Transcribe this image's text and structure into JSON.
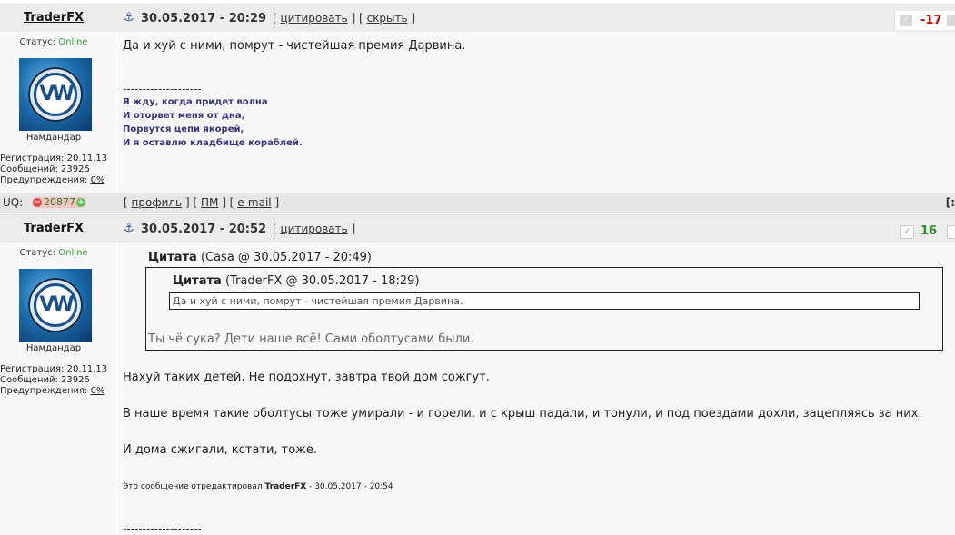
{
  "posts": [
    {
      "author": "TraderFX",
      "date": "30.05.2017 - 20:29",
      "links": {
        "open": "[",
        "quote": "цитировать",
        "mid": "] [",
        "hide": "скрыть",
        "close": "]"
      },
      "rating": "-17",
      "status_label": "Статус:",
      "status_value": "Online",
      "rank": "Намдандар",
      "reg": "Регистрация: 20.11.13",
      "msgs": "Сообщений: 23925",
      "warn_label": "Предупреждения:",
      "warn_value": "0%",
      "text": "Да и хуй с ними, помрут - чистейшая премия Дарвина.",
      "sig_sep": "--------------------",
      "sig_lines": [
        "Я жду, когда придет волна",
        "И оторвет меня от дна,",
        "Порвутся цепи якорей,",
        "И я оставлю кладбище кораблей."
      ]
    },
    {
      "author": "TraderFX",
      "date": "30.05.2017 - 20:52",
      "links": {
        "open": "[",
        "quote": "цитировать",
        "close": "]"
      },
      "rating": "16",
      "status_label": "Статус:",
      "status_value": "Online",
      "rank": "Намдандар",
      "reg": "Регистрация: 20.11.13",
      "msgs": "Сообщений: 23925",
      "warn_label": "Предупреждения:",
      "warn_value": "0%",
      "quote_outer": {
        "label": "Цитата",
        "source": "(Casa @ 30.05.2017 - 20:49)",
        "text": "Ты чё сука? Дети наше всё! Сами оболтусами были."
      },
      "quote_inner": {
        "label": "Цитата",
        "source": "(TraderFX @ 30.05.2017 - 18:29)",
        "text": "Да и хуй с ними, помрут - чистейшая премия Дарвина."
      },
      "paragraphs": [
        "Нахуй таких детей. Не подохнут, завтра твой дом сожгут.",
        "В наше время такие оболтусы тоже умирали - и горели, и с крыш падали, и тонули, и под поездами дохли, зацепляясь за них.",
        "И дома сжигали, кстати, тоже."
      ],
      "edit_prefix": "Это сообщение отредактировал",
      "edit_author": "TraderFX",
      "edit_suffix": "- 30.05.2017 - 20:54",
      "sig_sep": "--------------------"
    }
  ],
  "footer": {
    "uq_label": "UQ:",
    "uq_value": "20877",
    "open": "[",
    "profile": "профиль",
    "sep1": "] [",
    "pm": "ПМ",
    "sep2": "] [",
    "email": "e-mail",
    "close": "]",
    "edge": "[:"
  },
  "colors": {
    "negative": "#d40000",
    "positive": "#2a8a2a",
    "online": "#3aa03a",
    "signature": "#36367a"
  }
}
